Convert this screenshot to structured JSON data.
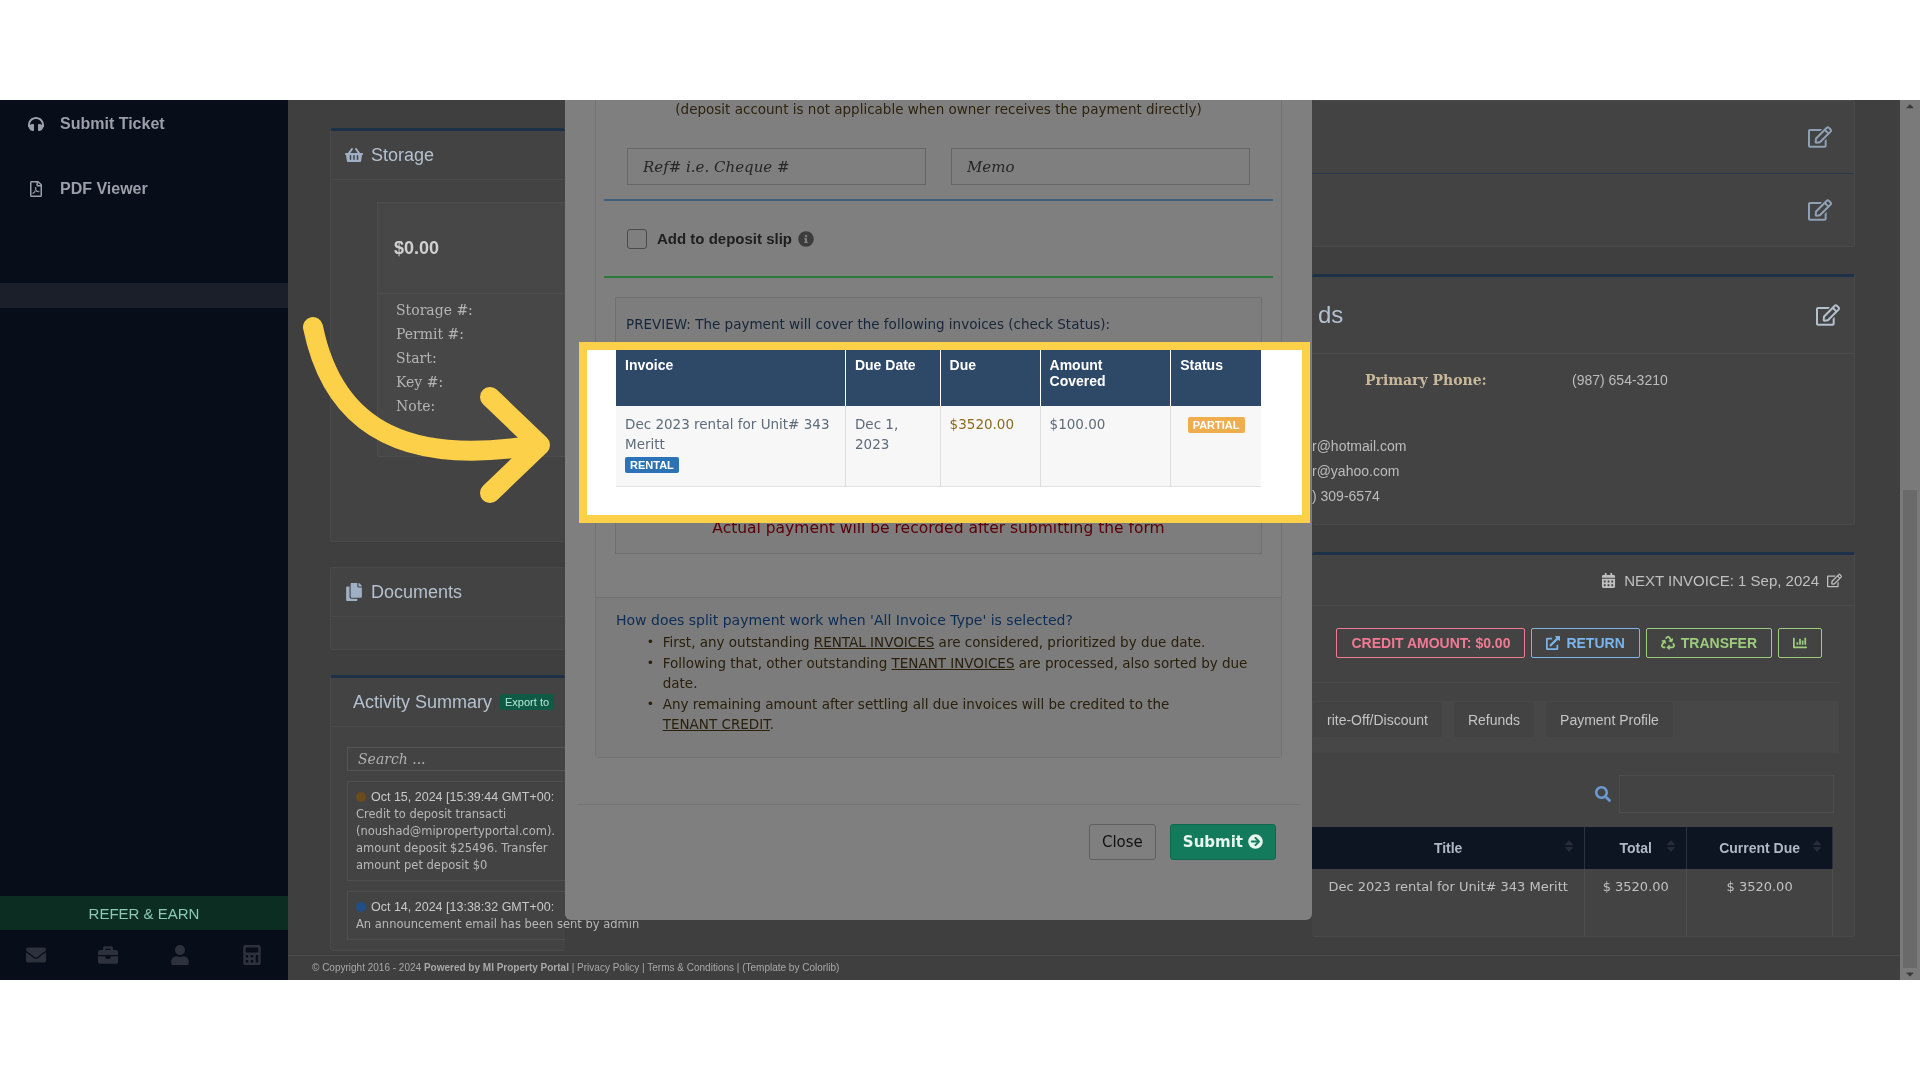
{
  "sidebar": {
    "items": [
      {
        "label": "Submit Ticket",
        "kind": "ticket"
      },
      {
        "label": "PDF Viewer",
        "kind": "pdf"
      }
    ],
    "refer_button": "REFER & EARN"
  },
  "storage": {
    "title": "Storage",
    "amount": "$0.00",
    "fields": [
      "Storage #:",
      "Permit #:",
      "Start:",
      "Key #:",
      "Note:"
    ]
  },
  "documents": {
    "title": "Documents"
  },
  "activity": {
    "title": "Activity Summary",
    "export_button": "Export to",
    "search": {
      "placeholder": "Search ..."
    },
    "items": [
      {
        "time": "Oct 15, 2024 [15:39:44 GMT+00:",
        "color": "#6b4a1c",
        "lines": [
          "Credit to deposit transacti",
          "(noushad@mipropertyportal.com).",
          "amount deposit $25496. Transfer",
          "amount pet deposit $0"
        ]
      },
      {
        "time": "Oct 14, 2024 [13:38:32 GMT+00:",
        "color": "#1f4f86",
        "lines": [
          "An announcement email has been sent by admin"
        ]
      }
    ]
  },
  "contact": {
    "heading": "ds",
    "fields": [
      {
        "label": "Primary Phone:",
        "value": "(987) 654-3210"
      }
    ],
    "lines": [
      "r@hotmail.com",
      "r@yahoo.com",
      ") 309-6574"
    ]
  },
  "billing": {
    "next_invoice": "NEXT INVOICE: 1 Sep, 2024",
    "buttons": [
      {
        "kind": "credit",
        "label": "CREDIT AMOUNT: $0.00"
      },
      {
        "kind": "return",
        "label": "RETURN"
      },
      {
        "kind": "transfer",
        "label": "TRANSFER"
      },
      {
        "kind": "chart"
      }
    ],
    "tabs": [
      {
        "label": "rite-Off/Discount",
        "selected": false
      },
      {
        "label": "Refunds",
        "selected": false
      },
      {
        "label": "Payment Profile",
        "selected": false
      }
    ],
    "table": {
      "columns": [
        "Title",
        "Total",
        "Current Due"
      ],
      "rows": [
        [
          "Dec 2023 rental for Unit# 343 Meritt",
          "$ 3520.00",
          "$ 3520.00"
        ]
      ]
    }
  },
  "footer": "© Copyright 2016 - 2024 **Powered by MI Property Portal** | Privacy Policy | Terms & Conditions | (Template by Colorlib)",
  "modal": {
    "deposit_note": "(deposit account is not applicable when owner receives the payment directly)",
    "ref_field": {
      "placeholder": "Ref# i.e. Cheque #"
    },
    "memo_field": {
      "placeholder": "Memo"
    },
    "deposit_slip": {
      "label": "Add to deposit slip",
      "checked": false
    },
    "preview": {
      "intro": "PREVIEW: The payment will cover the following invoices (check Status):",
      "columns": [
        "Invoice",
        "Due Date",
        "Due",
        "Amount Covered",
        "Status"
      ],
      "rows": [
        {
          "invoice": "Dec 2023 rental for Unit# 343 Meritt",
          "tag": "RENTAL",
          "due_date": "Dec 1, 2023",
          "due": "$3520.00",
          "covered": "$100.00",
          "status": "PARTIAL"
        }
      ],
      "note": "Actual payment will be recorded after submitting the form"
    },
    "help": {
      "question": "How does split payment work when 'All Invoice Type' is selected?",
      "bullets": [
        {
          "marker": "•",
          "parts": [
            {
              "text": "First, any outstanding "
            },
            {
              "text": "RENTAL INVOICES",
              "link": true
            },
            {
              "text": " are considered, prioritized by due date."
            }
          ]
        },
        {
          "marker": "•",
          "parts": [
            {
              "text": "Following that, other outstanding "
            },
            {
              "text": "TENANT INVOICES",
              "link": true
            },
            {
              "text": " are processed, also sorted by due date."
            }
          ]
        },
        {
          "marker": "•",
          "parts": [
            {
              "text": "Any remaining amount after settling all due invoices will be credited to the "
            },
            {
              "text": "TENANT CREDIT",
              "link": true
            },
            {
              "text": "."
            }
          ]
        }
      ]
    },
    "close_button": "Close",
    "submit_button": "Submit"
  }
}
